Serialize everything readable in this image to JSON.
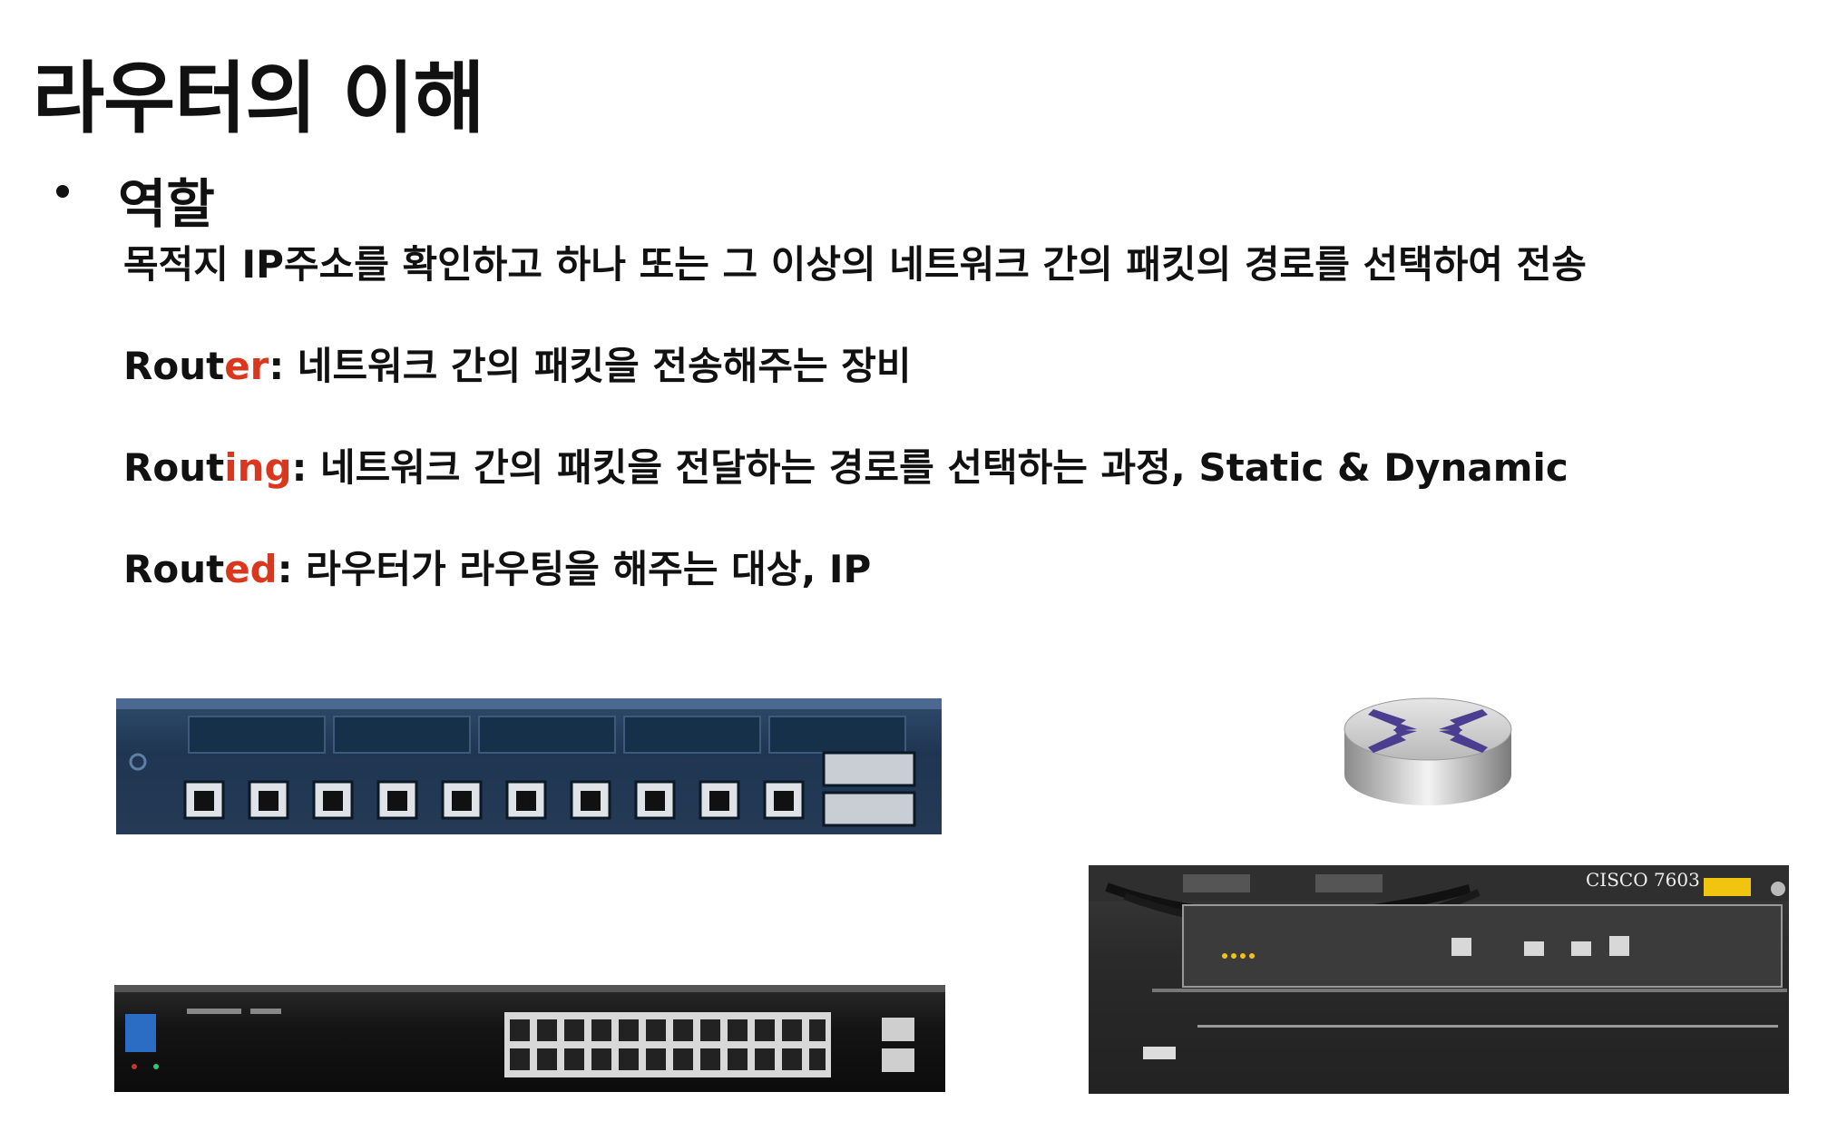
{
  "slide": {
    "title": "라우터의 이해",
    "section": "역할",
    "description": "목적지 IP주소를 확인하고 하나 또는 그 이상의 네트워크 간의 패킷의 경로를 선택하여 전송",
    "router": {
      "prefix": "Rout",
      "suffix": "er",
      "text": ": 네트워크 간의 패킷을 전송해주는 장비"
    },
    "routing": {
      "prefix": "Rout",
      "suffix": "ing",
      "text": ": 네트워크 간의 패킷을 전달하는 경로를 선택하는 과정, Static & Dynamic"
    },
    "routed": {
      "prefix": "Rout",
      "suffix": "ed",
      "text": ": 라우터가 라우팅을 해주는 대상, IP"
    }
  },
  "images": {
    "cisco_label": "CISCO 7603"
  },
  "colors": {
    "accent": "#d9381e",
    "text": "#111111"
  }
}
